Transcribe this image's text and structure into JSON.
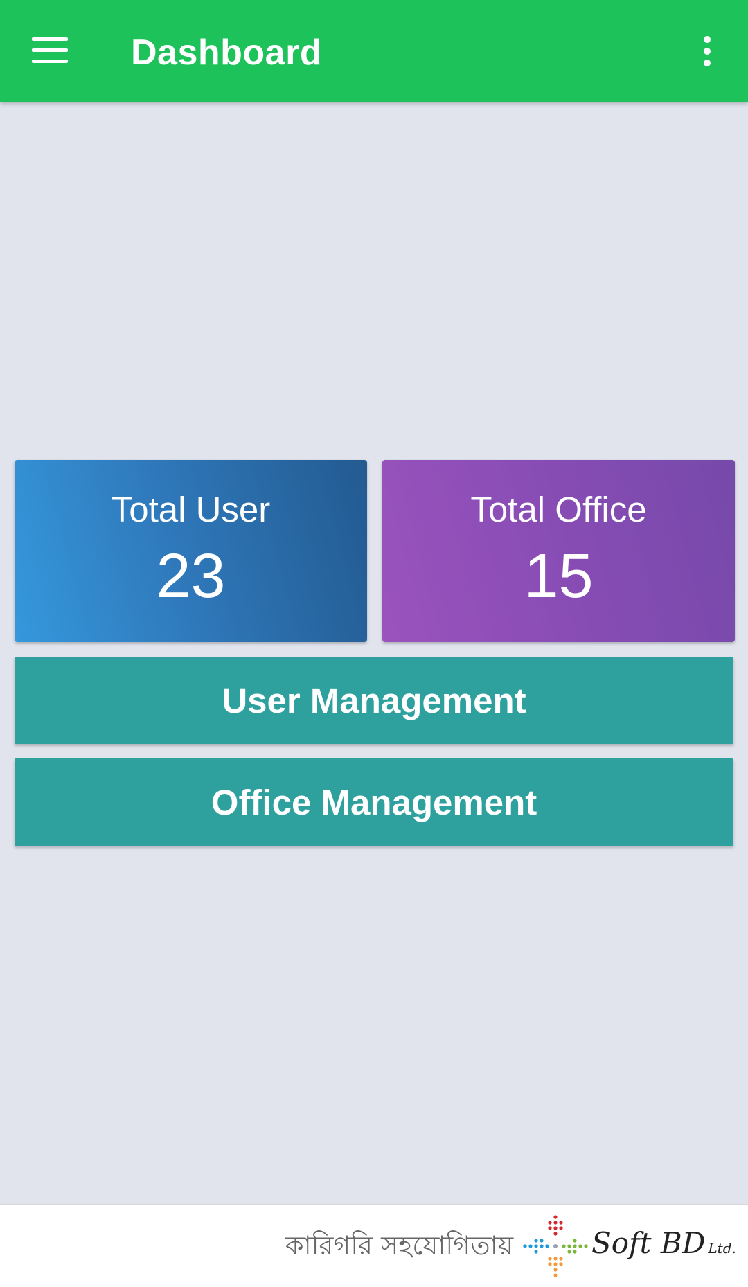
{
  "app_bar": {
    "title": "Dashboard",
    "menu_icon": "hamburger-menu-icon",
    "overflow_icon": "more-vertical-icon",
    "color": "#1dc25a"
  },
  "stats": {
    "total_user": {
      "label": "Total User",
      "value": "23"
    },
    "total_office": {
      "label": "Total Office",
      "value": "15"
    }
  },
  "actions": {
    "user_management": "User Management",
    "office_management": "Office Management",
    "color": "#2ea19f"
  },
  "footer": {
    "text": "কারিগরি সহযোগিতায়",
    "logo": {
      "name": "Soft BD",
      "suffix": "Ltd."
    }
  }
}
